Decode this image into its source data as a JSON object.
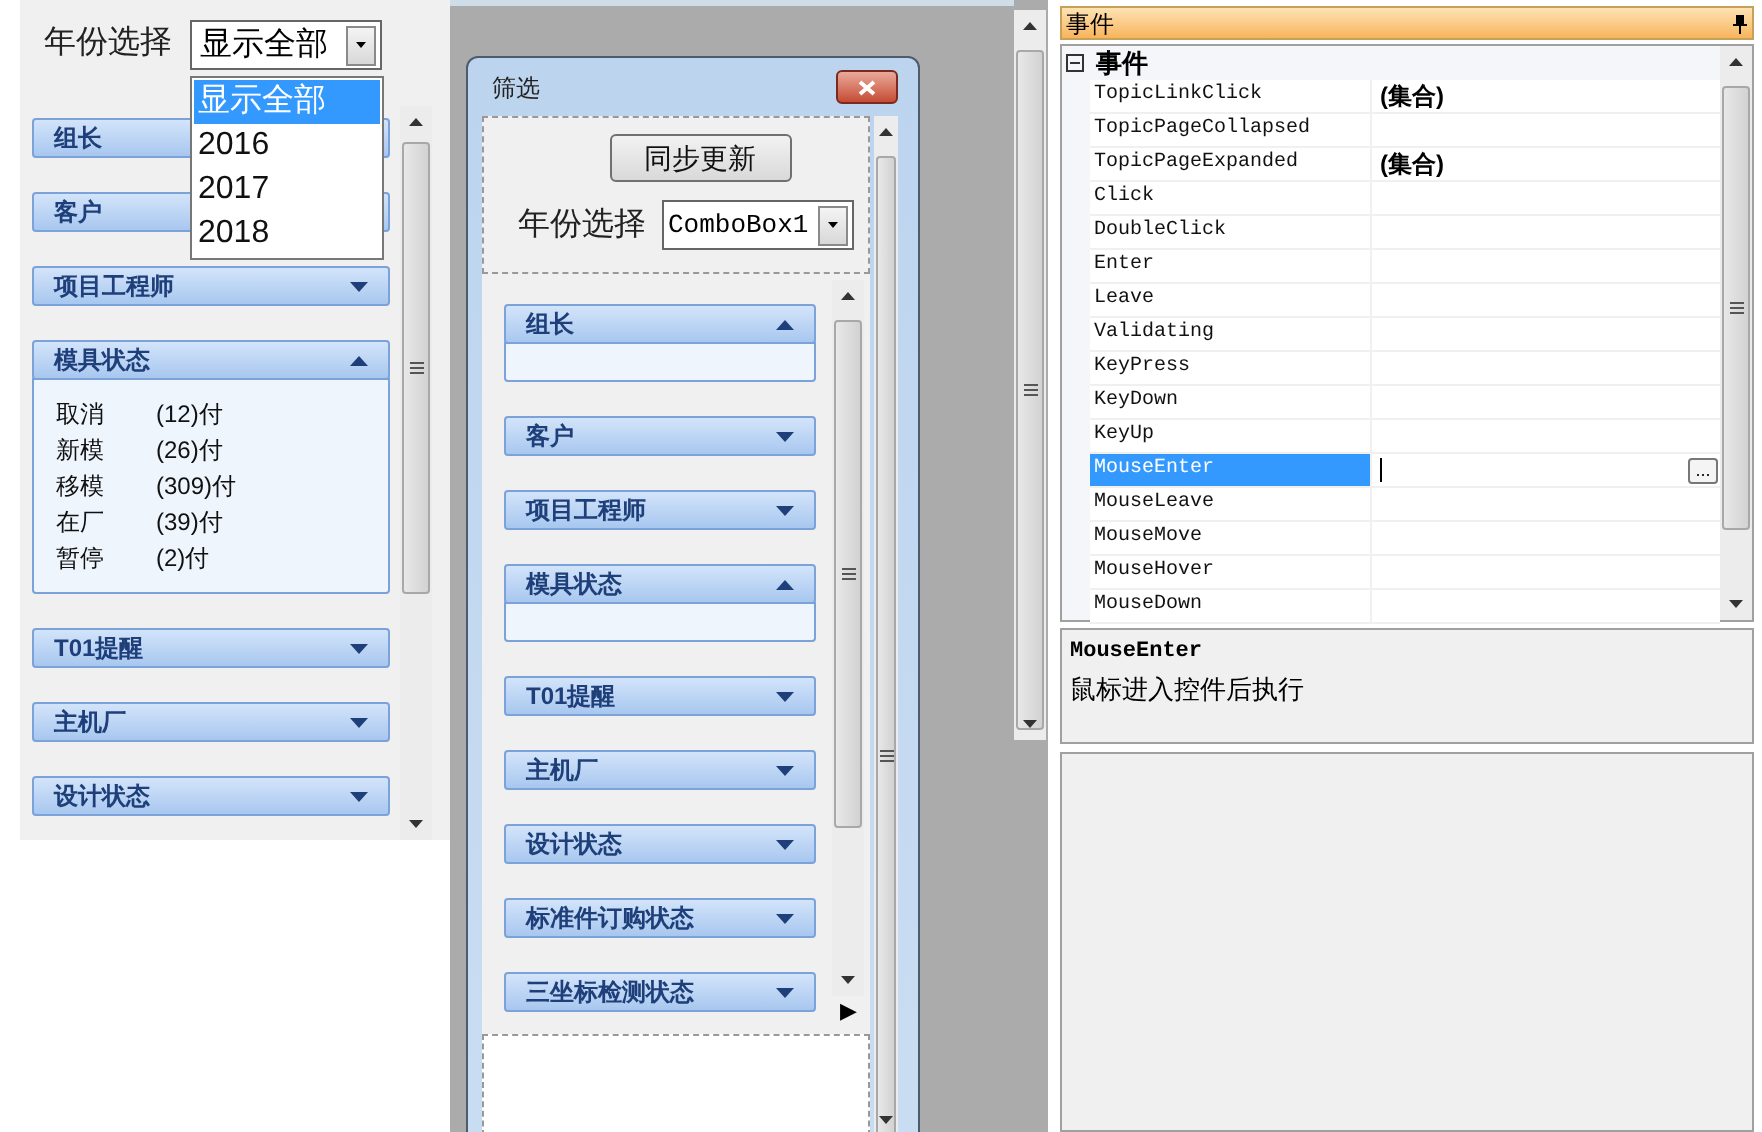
{
  "left_panel": {
    "year_label": "年份选择",
    "year_combo": {
      "value": "显示全部"
    },
    "dropdown": {
      "options": [
        {
          "label": "显示全部",
          "selected": true
        },
        {
          "label": "2016",
          "selected": false
        },
        {
          "label": "2017",
          "selected": false
        },
        {
          "label": "2018",
          "selected": false
        }
      ]
    },
    "groups": [
      {
        "title": "组长"
      },
      {
        "title": "客户"
      },
      {
        "title": "项目工程师",
        "expanded": false
      },
      {
        "title": "模具状态",
        "expanded": true,
        "items": [
          {
            "name": "取消",
            "count": "(12)付"
          },
          {
            "name": "新模",
            "count": "(26)付"
          },
          {
            "name": "移模",
            "count": "(309)付"
          },
          {
            "name": "在厂",
            "count": "(39)付"
          },
          {
            "name": "暂停",
            "count": "(2)付"
          }
        ]
      },
      {
        "title": "T01提醒",
        "expanded": false
      },
      {
        "title": "主机厂",
        "expanded": false
      },
      {
        "title": "设计状态",
        "expanded": false
      }
    ]
  },
  "designer_window": {
    "title": "筛选",
    "sync_button": "同步更新",
    "year_label": "年份选择",
    "combo_value": "ComboBox1",
    "scroll_right": "▶",
    "groups": [
      {
        "title": "组长",
        "expanded": true
      },
      {
        "title": "客户",
        "expanded": false
      },
      {
        "title": "项目工程师",
        "expanded": false
      },
      {
        "title": "模具状态",
        "expanded": true
      },
      {
        "title": "T01提醒",
        "expanded": false
      },
      {
        "title": "主机厂",
        "expanded": false
      },
      {
        "title": "设计状态",
        "expanded": false
      },
      {
        "title": "标准件订购状态",
        "expanded": false
      },
      {
        "title": "三坐标检测状态",
        "expanded": false
      }
    ]
  },
  "properties": {
    "title": "事件",
    "category": "事件",
    "category_expanded": true,
    "rows": [
      {
        "name": "TopicLinkClick",
        "value": "(集合)",
        "selected": false
      },
      {
        "name": "TopicPageCollapsed",
        "selected": false
      },
      {
        "name": "TopicPageExpanded",
        "value": "(集合)",
        "selected": false
      },
      {
        "name": "Click",
        "selected": false
      },
      {
        "name": "DoubleClick",
        "selected": false
      },
      {
        "name": "Enter",
        "selected": false
      },
      {
        "name": "Leave",
        "selected": false
      },
      {
        "name": "Validating",
        "selected": false
      },
      {
        "name": "KeyPress",
        "selected": false
      },
      {
        "name": "KeyDown",
        "selected": false
      },
      {
        "name": "KeyUp",
        "selected": false
      },
      {
        "name": "MouseEnter",
        "selected": true,
        "edit_button": "..."
      },
      {
        "name": "MouseLeave",
        "selected": false
      },
      {
        "name": "MouseMove",
        "selected": false
      },
      {
        "name": "MouseHover",
        "selected": false
      },
      {
        "name": "MouseDown",
        "selected": false
      }
    ],
    "description": {
      "title": "MouseEnter",
      "text": "鼠标进入控件后执行"
    }
  }
}
